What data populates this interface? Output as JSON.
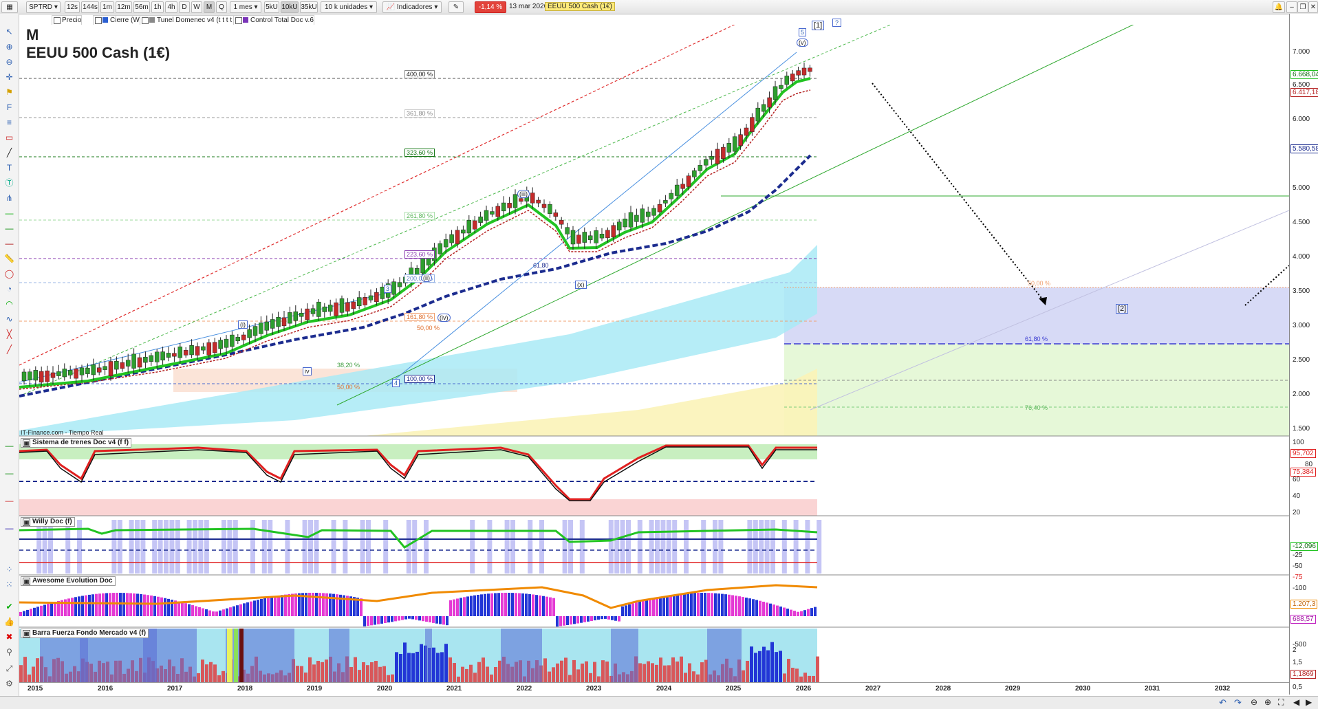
{
  "toolbar": {
    "symbol": "SPTRD",
    "intervals": [
      "12s",
      "144s",
      "1m",
      "12m",
      "56m",
      "1h",
      "4h",
      "D",
      "W",
      "M",
      "Q"
    ],
    "active_interval": "M",
    "period": "1 mes",
    "tick_buttons": [
      "5kU",
      "10kU",
      "35kU"
    ],
    "active_tick": "10kU",
    "units": "10 k unidades",
    "indicators_label": "Indicadores",
    "change": "-1,14 %",
    "date": "13 mar 2026",
    "instrument": "EEUU 500 Cash (1€)"
  },
  "subbar": {
    "items": [
      "Precio",
      "Cierre (W)",
      "Tunel Domenec v4 (t t t t t)",
      "Control Total Doc v.6"
    ]
  },
  "chart": {
    "timeframe": "M",
    "title": "EEUU 500 Cash (1€)",
    "source": "IT-Finance.com - Tiempo Real",
    "fib_labels": {
      "400": "400,00 %",
      "361": "361,80 %",
      "323": "323,60 %",
      "261": "261,80 %",
      "223": "223,60 %",
      "200": "200,00 %",
      "161": "161,80 %",
      "100": "100,00 %",
      "38": "38,20 %",
      "50": "50,00 %",
      "50b": "50,00 %",
      "618a": "61,80",
      "618b": "61,80 %",
      "764": "76,40 %",
      "50c": "50,00 %"
    },
    "wave_labels": {
      "w1": "[1]",
      "w2": "[2]",
      "q": "?",
      "v": "(v)",
      "five": "5",
      "iii": "(iii)",
      "iv": "(iv)",
      "x": "(x)",
      "ii": "(ii)",
      "i": "(i)",
      "three": "3",
      "four": "4",
      "iv2": "iv",
      "one": "1",
      "a": "a"
    }
  },
  "price_axis": {
    "labels": [
      "7.000",
      "6.500",
      "6.000",
      "5.000",
      "4.500",
      "4.000",
      "3.500",
      "3.000",
      "2.500",
      "2.000",
      "1.500"
    ],
    "boxes": {
      "last": "6.668,04",
      "ma1": "6.417,18",
      "ma2": "5.580,58"
    }
  },
  "panels": {
    "trenes": {
      "title": "Sistema de trenes Doc v4 (f f)",
      "axis": [
        "100",
        "80",
        "60",
        "40",
        "20"
      ],
      "boxes": [
        "95,702",
        "75,384"
      ]
    },
    "willy": {
      "title": "Willy Doc (f)",
      "axis": [
        "-25",
        "-50",
        "-75",
        "-100"
      ],
      "boxes": [
        "-12,096"
      ]
    },
    "awesome": {
      "title": "Awesome Evolution Doc",
      "axis": [
        "-500"
      ],
      "boxes": [
        "1.207,3",
        "688,57"
      ]
    },
    "barra": {
      "title": "Barra Fuerza Fondo Mercado v4 (f)",
      "axis": [
        "2",
        "1,5",
        "0,5"
      ],
      "boxes": [
        "1,1869"
      ]
    }
  },
  "years": [
    "2015",
    "2016",
    "2017",
    "2018",
    "2019",
    "2020",
    "2021",
    "2022",
    "2023",
    "2024",
    "2025",
    "2026",
    "2027",
    "2028",
    "2029",
    "2030",
    "2031",
    "2032"
  ],
  "colors": {
    "green": "#22c322",
    "navy": "#1c2c8f",
    "red": "#e03030",
    "band_blue": "#d7daf6",
    "band_green": "#e6f8d8"
  }
}
